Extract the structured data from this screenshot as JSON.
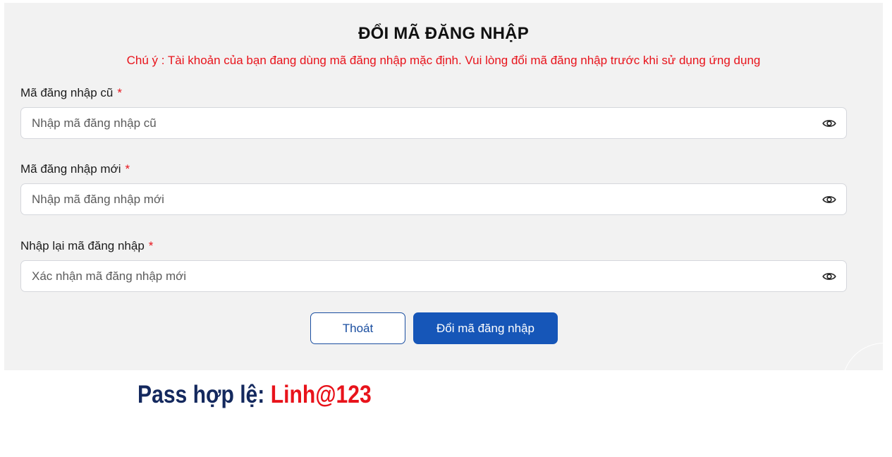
{
  "dialog": {
    "title": "ĐỔI MÃ ĐĂNG NHẬP",
    "notice": "Chú ý : Tài khoản của bạn đang dùng mã đăng nhập mặc định. Vui lòng đổi mã đăng nhập trước khi sử dụng ứng dụng",
    "required_mark": "*",
    "fields": [
      {
        "label": "Mã đăng nhập cũ",
        "placeholder": "Nhập mã đăng nhập cũ",
        "value": "",
        "icon": "eye-icon"
      },
      {
        "label": "Mã đăng nhập mới",
        "placeholder": "Nhập mã đăng nhập mới",
        "value": "",
        "icon": "eye-icon"
      },
      {
        "label": "Nhập lại mã đăng nhập",
        "placeholder": "Xác nhận mã đăng nhập mới",
        "value": "",
        "icon": "eye-icon"
      }
    ],
    "buttons": {
      "exit_label": "Thoát",
      "submit_label": "Đổi mã đăng nhập"
    }
  },
  "annotation": {
    "label": "Pass hợp lệ: ",
    "password": "Linh@123"
  },
  "colors": {
    "accent": "#1656b8",
    "warning": "#e8131b",
    "annotation_label": "#14295e",
    "panel_background": "#f2f2f2"
  }
}
